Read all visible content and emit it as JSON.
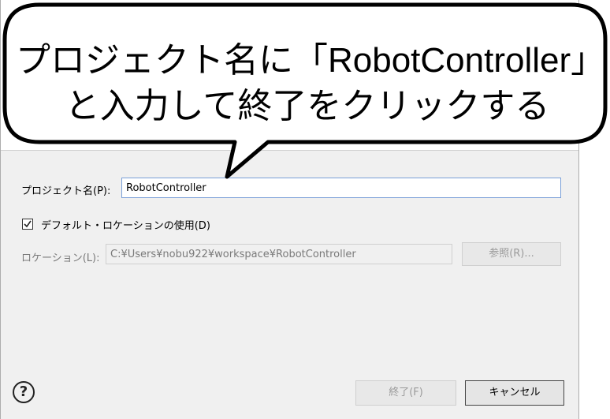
{
  "dialog": {
    "project_name_label": "プロジェクト名(P):",
    "project_name_value": "RobotController",
    "default_location_label": "デフォルト・ロケーションの使用(D)",
    "default_location_checked": true,
    "location_label": "ロケーション(L):",
    "location_value": "C:¥Users¥nobu922¥workspace¥RobotController",
    "browse_button": "参照(R)...",
    "finish_button": "終了(F)",
    "cancel_button": "キャンセル",
    "help_icon": "?"
  },
  "callout": {
    "line1": "プロジェクト名に「RobotController」",
    "line2": "と入力して終了をクリックする"
  },
  "icons": {
    "help": "question-circle-icon",
    "checkbox": "checkmark-icon"
  },
  "colors": {
    "input_border": "#7a9fd8",
    "dialog_bg": "#f0f0f0"
  }
}
